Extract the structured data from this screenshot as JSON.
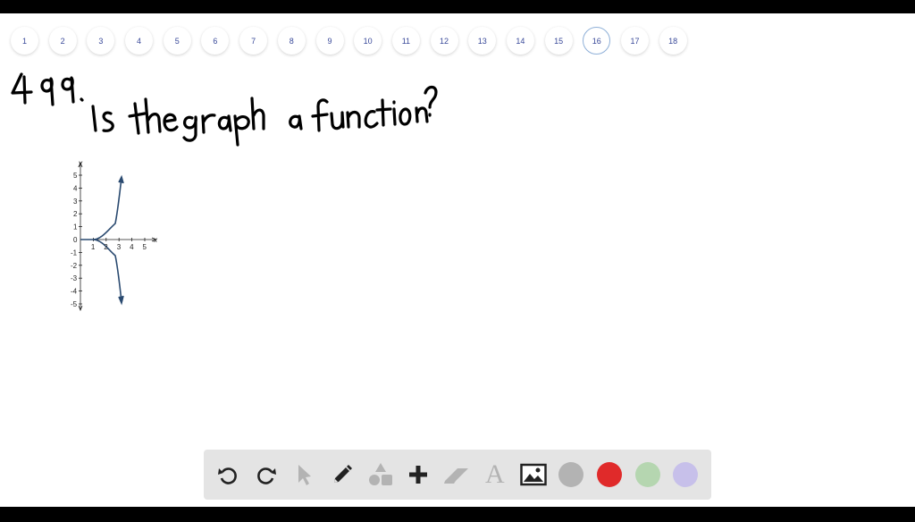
{
  "pages": [
    "1",
    "2",
    "3",
    "4",
    "5",
    "6",
    "7",
    "8",
    "9",
    "10",
    "11",
    "12",
    "13",
    "14",
    "15",
    "16",
    "17",
    "18"
  ],
  "active_page": "16",
  "question": {
    "number": "499.",
    "text": "Is the graph a function?"
  },
  "graph": {
    "x_label": "x",
    "y_label": "y",
    "x_ticks": [
      "1",
      "2",
      "3",
      "4",
      "5"
    ],
    "y_ticks": [
      "5",
      "4",
      "3",
      "2",
      "1",
      "0",
      "-1",
      "-2",
      "-3",
      "-4",
      "-5"
    ]
  },
  "toolbar": {
    "tools": [
      "undo-icon",
      "redo-icon",
      "pointer-icon",
      "pencil-icon",
      "shapes-icon",
      "add-icon",
      "eraser-icon",
      "text-icon",
      "image-icon"
    ],
    "text_tool_label": "A",
    "colors": [
      "#b3b3b3",
      "#e02a2a",
      "#b5d6b0",
      "#c7c0ea"
    ]
  }
}
